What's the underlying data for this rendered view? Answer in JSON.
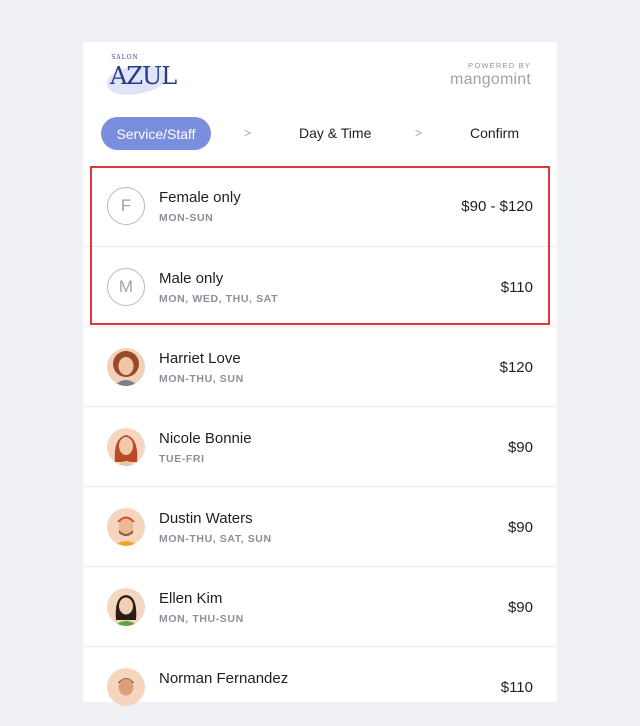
{
  "header": {
    "logo_small": "SALON",
    "logo_main": "AZUL",
    "powered_by": "POWERED BY",
    "brand": "mangomint"
  },
  "steps": {
    "active": "Service/Staff",
    "sep1": ">",
    "day_time": "Day & Time",
    "sep2": ">",
    "confirm": "Confirm"
  },
  "rows": [
    {
      "initial": "F",
      "name": "Female only",
      "days": "MON-SUN",
      "price": "$90 - $120"
    },
    {
      "initial": "M",
      "name": "Male only",
      "days": "MON, WED, THU, SAT",
      "price": "$110"
    },
    {
      "name": "Harriet Love",
      "days": "MON-THU, SUN",
      "price": "$120"
    },
    {
      "name": "Nicole Bonnie",
      "days": "TUE-FRI",
      "price": "$90"
    },
    {
      "name": "Dustin Waters",
      "days": "MON-THU, SAT, SUN",
      "price": "$90"
    },
    {
      "name": "Ellen Kim",
      "days": "MON, THU-SUN",
      "price": "$90"
    },
    {
      "name": "Norman Fernandez",
      "days": "",
      "price": "$110"
    }
  ],
  "colors": {
    "accent": "#7b8ddd",
    "highlight_border": "#e0353a",
    "background": "#eff1f5"
  }
}
